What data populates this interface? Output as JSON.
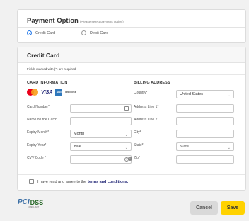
{
  "payment_option": {
    "title": "Payment Option",
    "subtitle": "(Please select payment option)",
    "options": [
      {
        "label": "Credit Card",
        "selected": true
      },
      {
        "label": "Debit Card",
        "selected": false
      }
    ]
  },
  "credit_card": {
    "title": "Credit Card",
    "required_note": "Fields marked with (*) are required",
    "card_info": {
      "heading": "CARD INFORMATION",
      "logos": [
        "mastercard-icon",
        "visa-icon",
        "amex-icon",
        "discover-icon"
      ],
      "visa_text": "VISA",
      "amex_text": "AMEX",
      "discover_text": "DISCOVER",
      "fields": {
        "card_number": {
          "label": "Card Number*",
          "value": ""
        },
        "name_on_card": {
          "label": "Name on the Card*",
          "value": ""
        },
        "expiry_month": {
          "label": "Expiry Month*",
          "value": "Month"
        },
        "expiry_year": {
          "label": "Expiry Year*",
          "value": "Year"
        },
        "cvv": {
          "label": "CVV Code *",
          "value": ""
        }
      }
    },
    "billing": {
      "heading": "BILLING ADDRESS",
      "fields": {
        "country": {
          "label": "Country*",
          "value": "United States"
        },
        "address1": {
          "label": "Address Line 1*",
          "value": ""
        },
        "address2": {
          "label": "Address Line 2",
          "value": ""
        },
        "city": {
          "label": "City*",
          "value": ""
        },
        "state": {
          "label": "State*",
          "value": "State"
        },
        "zip": {
          "label": "Zip*",
          "value": ""
        }
      }
    },
    "terms": {
      "prefix": "I have read and agree to the",
      "link": "terms and conditions."
    }
  },
  "footer": {
    "pci_mark": "PCI",
    "pci_dss": "DSS",
    "pci_sub": "COMPLIANT",
    "cancel_label": "Cancel",
    "save_label": "Save"
  },
  "colors": {
    "accent": "#1a73e8",
    "save_button": "#ffd200",
    "cancel_button": "#d9d9d9",
    "background": "#f1f1f1"
  }
}
